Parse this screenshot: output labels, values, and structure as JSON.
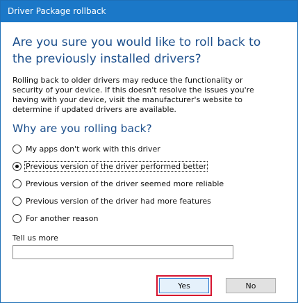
{
  "window": {
    "title": "Driver Package rollback"
  },
  "dialog": {
    "heading": "Are you sure you would like to roll back to the previously installed drivers?",
    "description": "Rolling back to older drivers may reduce the functionality or security of your device.  If this doesn't resolve the issues you're having with your device, visit the manufacturer's website to determine if updated drivers are available.",
    "subheading": "Why are you rolling back?",
    "options": [
      {
        "label": "My apps don't work with this driver",
        "checked": false
      },
      {
        "label": "Previous version of the driver performed better",
        "checked": true
      },
      {
        "label": "Previous version of the driver seemed more reliable",
        "checked": false
      },
      {
        "label": "Previous version of the driver had more features",
        "checked": false
      },
      {
        "label": "For another reason",
        "checked": false
      }
    ],
    "tell_us_more_label": "Tell us more",
    "tell_us_more_value": ""
  },
  "buttons": {
    "yes_label": "Yes",
    "no_label": "No"
  },
  "colors": {
    "titlebar": "#1b78c8",
    "heading": "#1c4f8c",
    "highlight": "#d6142f"
  }
}
